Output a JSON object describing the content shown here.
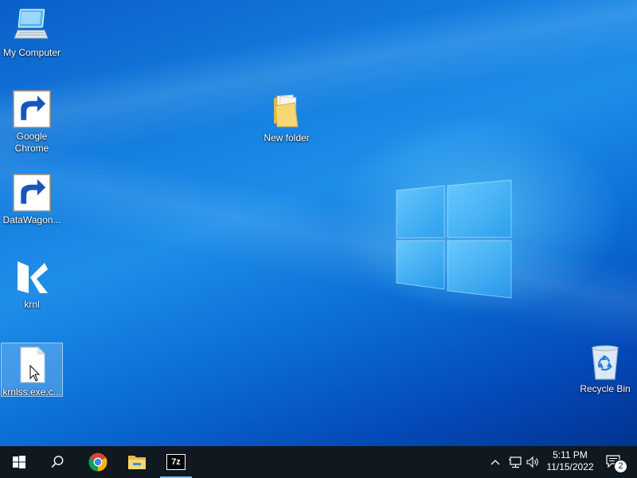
{
  "desktop": {
    "icons": [
      {
        "label": "My Computer",
        "icon": "computer-icon"
      },
      {
        "label": "Google Chrome",
        "icon": "chrome-icon",
        "shortcut": true
      },
      {
        "label": "DataWagon...",
        "icon": "datawagon-icon",
        "shortcut": true
      },
      {
        "label": "krnl",
        "icon": "krnl-icon"
      },
      {
        "label": "krnlss.exe.c...",
        "icon": "blank-file-icon",
        "selected": true
      },
      {
        "label": "New folder",
        "icon": "folder-icon"
      },
      {
        "label": "Recycle Bin",
        "icon": "recycle-bin-icon"
      }
    ]
  },
  "taskbar": {
    "buttons": [
      {
        "name": "start",
        "icon": "windows-start-icon"
      },
      {
        "name": "search",
        "icon": "search-icon"
      },
      {
        "name": "chrome",
        "icon": "chrome-icon"
      },
      {
        "name": "file-explorer",
        "icon": "folder-icon"
      },
      {
        "name": "7zip",
        "icon": "7zip-icon",
        "label": "7z",
        "active": true
      }
    ],
    "tray_icons": [
      "chevron-up-icon",
      "network-icon",
      "volume-icon"
    ],
    "clock": {
      "time": "5:11 PM",
      "date": "11/15/2022"
    },
    "notifications": {
      "icon": "action-center-icon",
      "count": "2"
    }
  },
  "colors": {
    "taskbar": "#101820",
    "desktop_blue": "#0b6fd6",
    "accent": "#76b9ed"
  }
}
